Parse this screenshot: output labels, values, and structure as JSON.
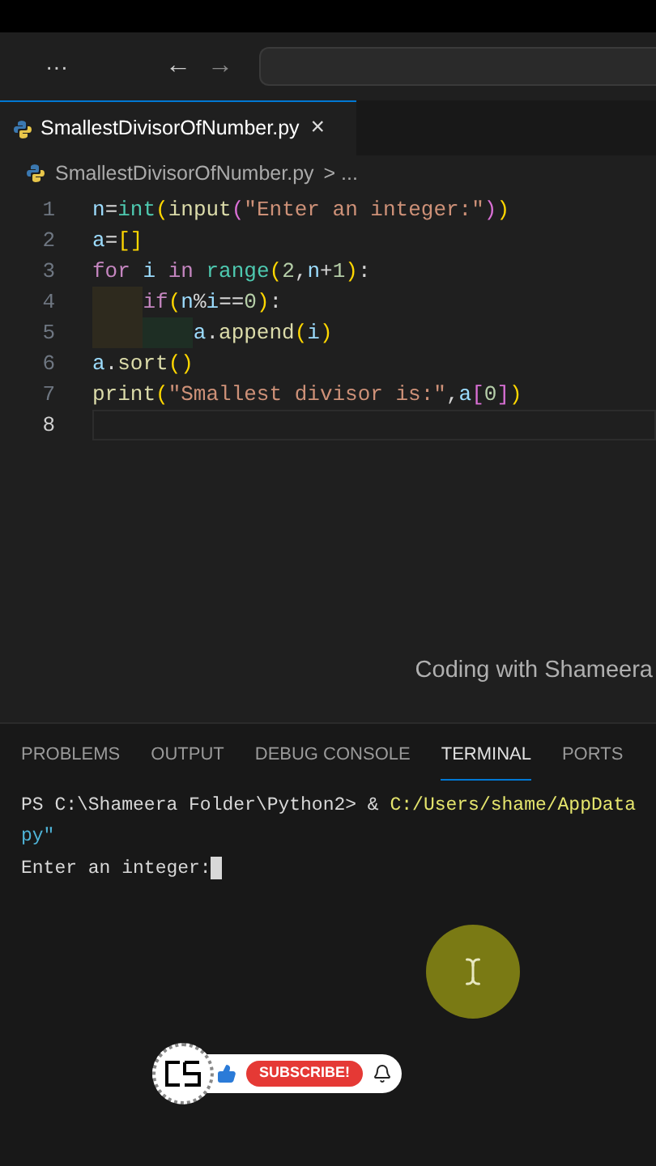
{
  "title_bar": {
    "more": "···",
    "back": "←",
    "forward": "→"
  },
  "tabs": [
    {
      "label": "SmallestDivisorOfNumber.py",
      "close": "×",
      "selected": true
    }
  ],
  "breadcrumb": {
    "file": "SmallestDivisorOfNumber.py",
    "rest": "> ..."
  },
  "code_lines": [
    {
      "number": "1",
      "current": false,
      "tokens": [
        {
          "kind": "var",
          "text": "n"
        },
        {
          "kind": "op",
          "text": "="
        },
        {
          "kind": "type",
          "text": "int"
        },
        {
          "kind": "b1",
          "text": "("
        },
        {
          "kind": "func",
          "text": "input"
        },
        {
          "kind": "b2",
          "text": "("
        },
        {
          "kind": "string",
          "text": "\"Enter an integer:\""
        },
        {
          "kind": "b2",
          "text": ")"
        },
        {
          "kind": "b1",
          "text": ")"
        }
      ]
    },
    {
      "number": "2",
      "current": false,
      "tokens": [
        {
          "kind": "var",
          "text": "a"
        },
        {
          "kind": "op",
          "text": "="
        },
        {
          "kind": "b1",
          "text": "[]"
        }
      ]
    },
    {
      "number": "3",
      "current": false,
      "tokens": [
        {
          "kind": "keyword",
          "text": "for "
        },
        {
          "kind": "var",
          "text": "i"
        },
        {
          "kind": "keyword",
          "text": " in "
        },
        {
          "kind": "type",
          "text": "range"
        },
        {
          "kind": "b1",
          "text": "("
        },
        {
          "kind": "number",
          "text": "2"
        },
        {
          "kind": "op",
          "text": ","
        },
        {
          "kind": "var",
          "text": "n"
        },
        {
          "kind": "op",
          "text": "+"
        },
        {
          "kind": "number",
          "text": "1"
        },
        {
          "kind": "b1",
          "text": ")"
        },
        {
          "kind": "op",
          "text": ":"
        }
      ]
    },
    {
      "number": "4",
      "current": false,
      "tokens": [
        {
          "kind": "indent"
        },
        {
          "kind": "keyword",
          "text": "if"
        },
        {
          "kind": "b1",
          "text": "("
        },
        {
          "kind": "var",
          "text": "n"
        },
        {
          "kind": "op",
          "text": "%"
        },
        {
          "kind": "var",
          "text": "i"
        },
        {
          "kind": "op",
          "text": "=="
        },
        {
          "kind": "number",
          "text": "0"
        },
        {
          "kind": "b1",
          "text": ")"
        },
        {
          "kind": "op",
          "text": ":"
        }
      ]
    },
    {
      "number": "5",
      "current": false,
      "tokens": [
        {
          "kind": "indent"
        },
        {
          "kind": "indent"
        },
        {
          "kind": "var",
          "text": "a"
        },
        {
          "kind": "op",
          "text": "."
        },
        {
          "kind": "func",
          "text": "append"
        },
        {
          "kind": "b1",
          "text": "("
        },
        {
          "kind": "var",
          "text": "i"
        },
        {
          "kind": "b1",
          "text": ")"
        }
      ]
    },
    {
      "number": "6",
      "current": false,
      "tokens": [
        {
          "kind": "var",
          "text": "a"
        },
        {
          "kind": "op",
          "text": "."
        },
        {
          "kind": "func",
          "text": "sort"
        },
        {
          "kind": "b1",
          "text": "()"
        }
      ]
    },
    {
      "number": "7",
      "current": false,
      "tokens": [
        {
          "kind": "func",
          "text": "print"
        },
        {
          "kind": "b1",
          "text": "("
        },
        {
          "kind": "string",
          "text": "\"Smallest divisor is:\""
        },
        {
          "kind": "op",
          "text": ","
        },
        {
          "kind": "var",
          "text": "a"
        },
        {
          "kind": "b2",
          "text": "["
        },
        {
          "kind": "number",
          "text": "0"
        },
        {
          "kind": "b2",
          "text": "]"
        },
        {
          "kind": "b1",
          "text": ")"
        }
      ]
    },
    {
      "number": "8",
      "current": true
    }
  ],
  "caption": "Coding with Shameera",
  "panel_tabs": [
    {
      "label": "PROBLEMS",
      "selected": false
    },
    {
      "label": "OUTPUT",
      "selected": false
    },
    {
      "label": "DEBUG CONSOLE",
      "selected": false
    },
    {
      "label": "TERMINAL",
      "selected": true
    },
    {
      "label": "PORTS",
      "selected": false
    }
  ],
  "terminal": {
    "prompt": "PS C:\\Shameera Folder\\Python2> & ",
    "path": "C:/Users/shame/AppData",
    "continuation": "py\"",
    "output": "Enter an integer:"
  },
  "subscribe": {
    "label": "SUBSCRIBE!"
  }
}
